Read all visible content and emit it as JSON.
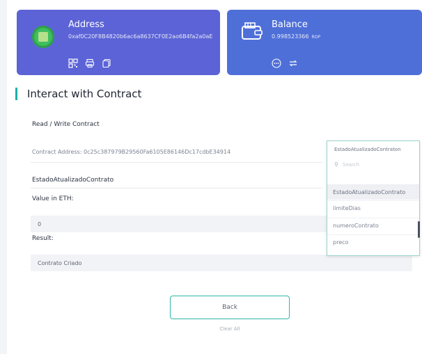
{
  "address_card": {
    "title": "Address",
    "value": "0xaf0C20F8B4820b6ac6a8637CF0E2ao6B4fa2a0aE"
  },
  "balance_card": {
    "title": "Balance",
    "value": "0.998523366",
    "unit": "ROP"
  },
  "section": {
    "title": "Interact with Contract"
  },
  "form": {
    "read_write_label": "Read / Write Contract",
    "contract_address_label": "Contract Address: 0c25c387979B29560Fa6105E86146Dc17cdbE34914",
    "function_name": "EstadoAtualizadoContrato",
    "value_in_eth_label": "Value in ETH:",
    "value_in_eth": "0",
    "result_label": "Result:",
    "result_value": "Contrato Criado"
  },
  "dropdown": {
    "selected": "EstadoAtualizadoContraton",
    "search_placeholder": "Search",
    "items": [
      "EstadoAtualizadoContrato",
      "limiteDias",
      "numeroContrato",
      "preco"
    ]
  },
  "buttons": {
    "back": "Back",
    "clear_all": "Clear All"
  },
  "colors": {
    "address_card": "#5b63d6",
    "balance_card": "#4f6fd8",
    "accent": "#19b1a6"
  }
}
